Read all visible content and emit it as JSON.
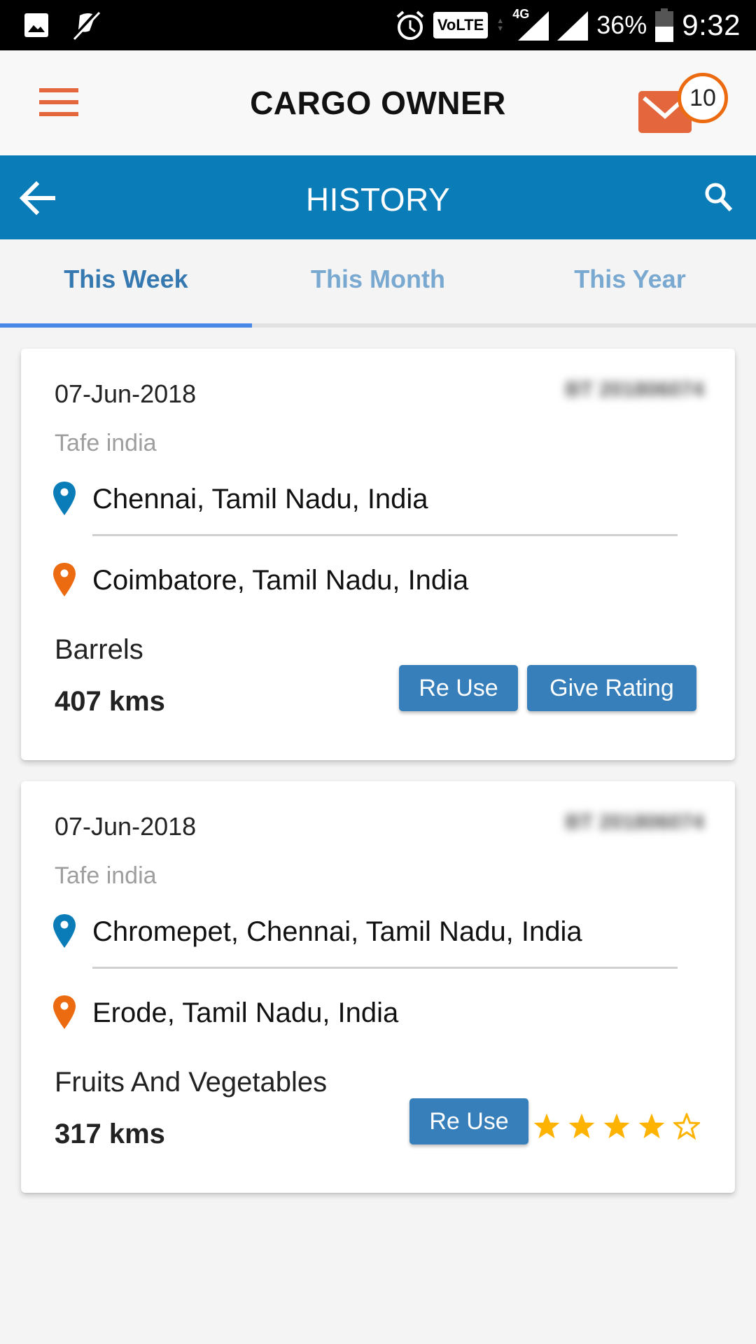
{
  "status_bar": {
    "time": "9:32",
    "battery_percent": "36%",
    "network": "4G",
    "volte_label": "VoLTE",
    "icons": [
      "image-icon",
      "mute-off-icon",
      "alarm-icon",
      "volte-icon",
      "data-arrows-icon",
      "signal-4g-icon",
      "signal-icon",
      "battery-icon"
    ]
  },
  "app_header": {
    "title": "CARGO OWNER",
    "menu_icon": "hamburger-menu-icon",
    "mail_icon": "mail-icon",
    "notification_count": "10"
  },
  "toolbar": {
    "title": "HISTORY",
    "back_icon": "arrow-left-icon",
    "search_icon": "search-icon"
  },
  "tabs": [
    {
      "label": "This Week",
      "active": true
    },
    {
      "label": "This Month",
      "active": false
    },
    {
      "label": "This Year",
      "active": false
    }
  ],
  "colors": {
    "primary": "#0a7db9",
    "accent_orange": "#e4663c",
    "button_blue": "#377fba",
    "pickup_pin": "#0a7db9",
    "drop_pin": "#ec6a10",
    "star": "#fdb300"
  },
  "trips": [
    {
      "date": "07-Jun-2018",
      "trip_id": "BT 201806074",
      "company": "Tafe india",
      "pickup": "Chennai, Tamil Nadu, India",
      "drop": "Coimbatore, Tamil Nadu, India",
      "cargo": "Barrels",
      "distance": "407 kms",
      "buttons": {
        "reuse": "Re Use",
        "rate": "Give Rating"
      },
      "rating": null
    },
    {
      "date": "07-Jun-2018",
      "trip_id": "BT 201806074",
      "company": "Tafe india",
      "pickup": "Chromepet, Chennai, Tamil Nadu, India",
      "drop": "Erode, Tamil Nadu, India",
      "cargo": "Fruits And Vegetables",
      "distance": "317 kms",
      "buttons": {
        "reuse": "Re Use"
      },
      "rating": {
        "value": 4,
        "max": 5
      }
    }
  ]
}
